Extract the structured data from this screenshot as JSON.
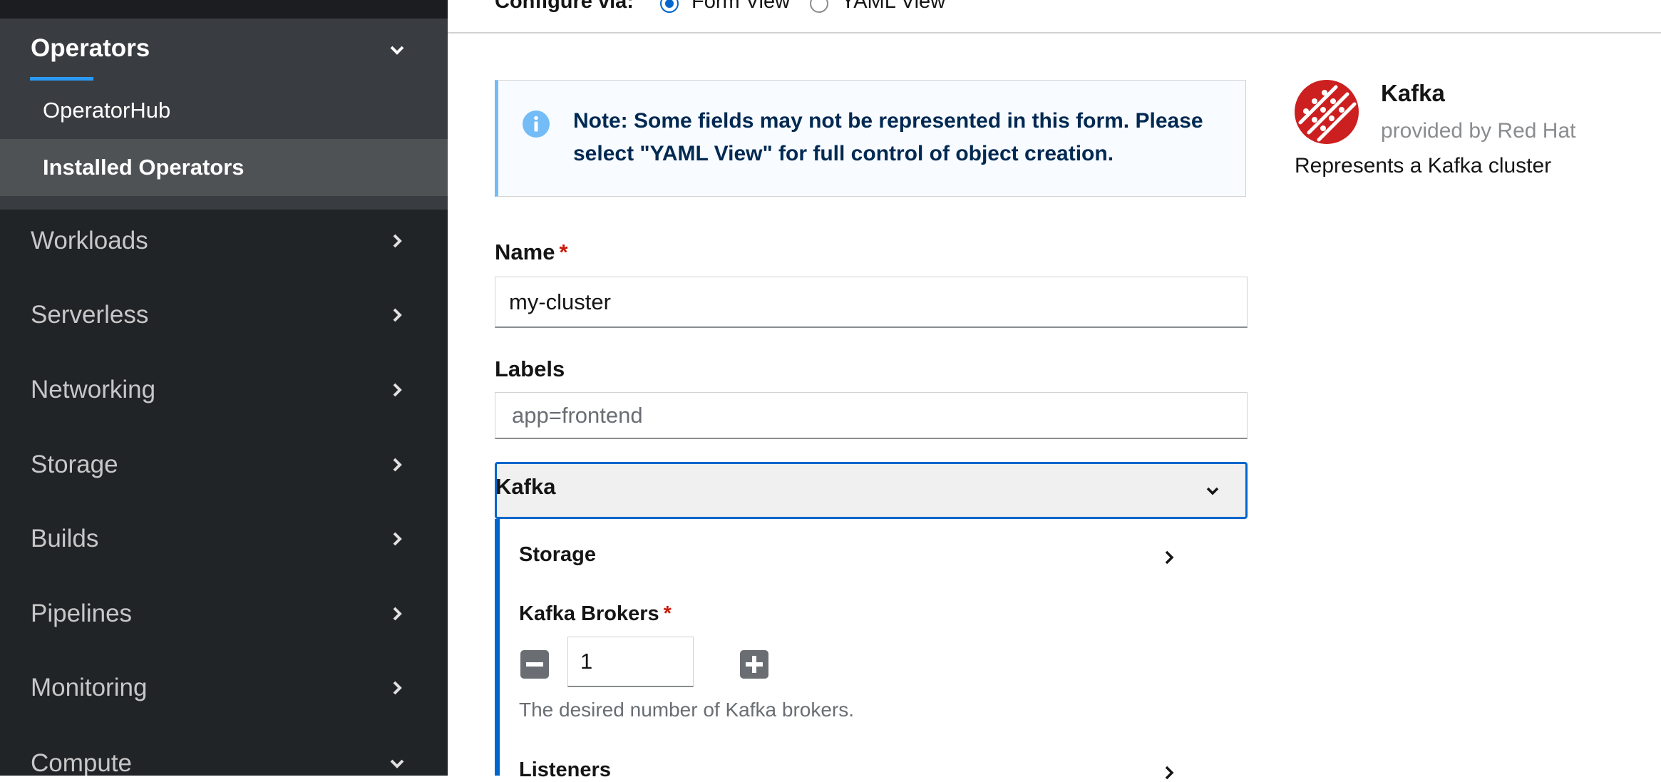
{
  "sidebar": {
    "operators": {
      "label": "Operators",
      "items": [
        {
          "label": "OperatorHub"
        },
        {
          "label": "Installed Operators"
        }
      ]
    },
    "groups": [
      {
        "label": "Workloads"
      },
      {
        "label": "Serverless"
      },
      {
        "label": "Networking"
      },
      {
        "label": "Storage"
      },
      {
        "label": "Builds"
      },
      {
        "label": "Pipelines"
      },
      {
        "label": "Monitoring"
      },
      {
        "label": "Compute"
      }
    ]
  },
  "configure": {
    "label": "Configure via:",
    "options": [
      {
        "label": "Form View",
        "selected": true
      },
      {
        "label": "YAML View",
        "selected": false
      }
    ]
  },
  "alert": {
    "icon": "info-circle-icon",
    "text": "Note: Some fields may not be represented in this form. Please select \"YAML View\" for full control of object creation."
  },
  "form": {
    "name": {
      "label": "Name",
      "required_mark": "*",
      "value": "my-cluster"
    },
    "labels": {
      "label": "Labels",
      "placeholder": "app=frontend"
    },
    "kafka": {
      "title": "Kafka",
      "storage_label": "Storage",
      "brokers": {
        "label": "Kafka Brokers",
        "required_mark": "*",
        "value": "1",
        "helper": "The desired number of Kafka brokers."
      },
      "listeners_label": "Listeners"
    }
  },
  "card": {
    "title": "Kafka",
    "provider": "provided by Red Hat",
    "description": "Represents a Kafka cluster"
  },
  "colors": {
    "sidebar_bg": "#212427",
    "accent": "#0066cc",
    "required": "#c9190b",
    "logo_red": "#cc1f1f"
  }
}
